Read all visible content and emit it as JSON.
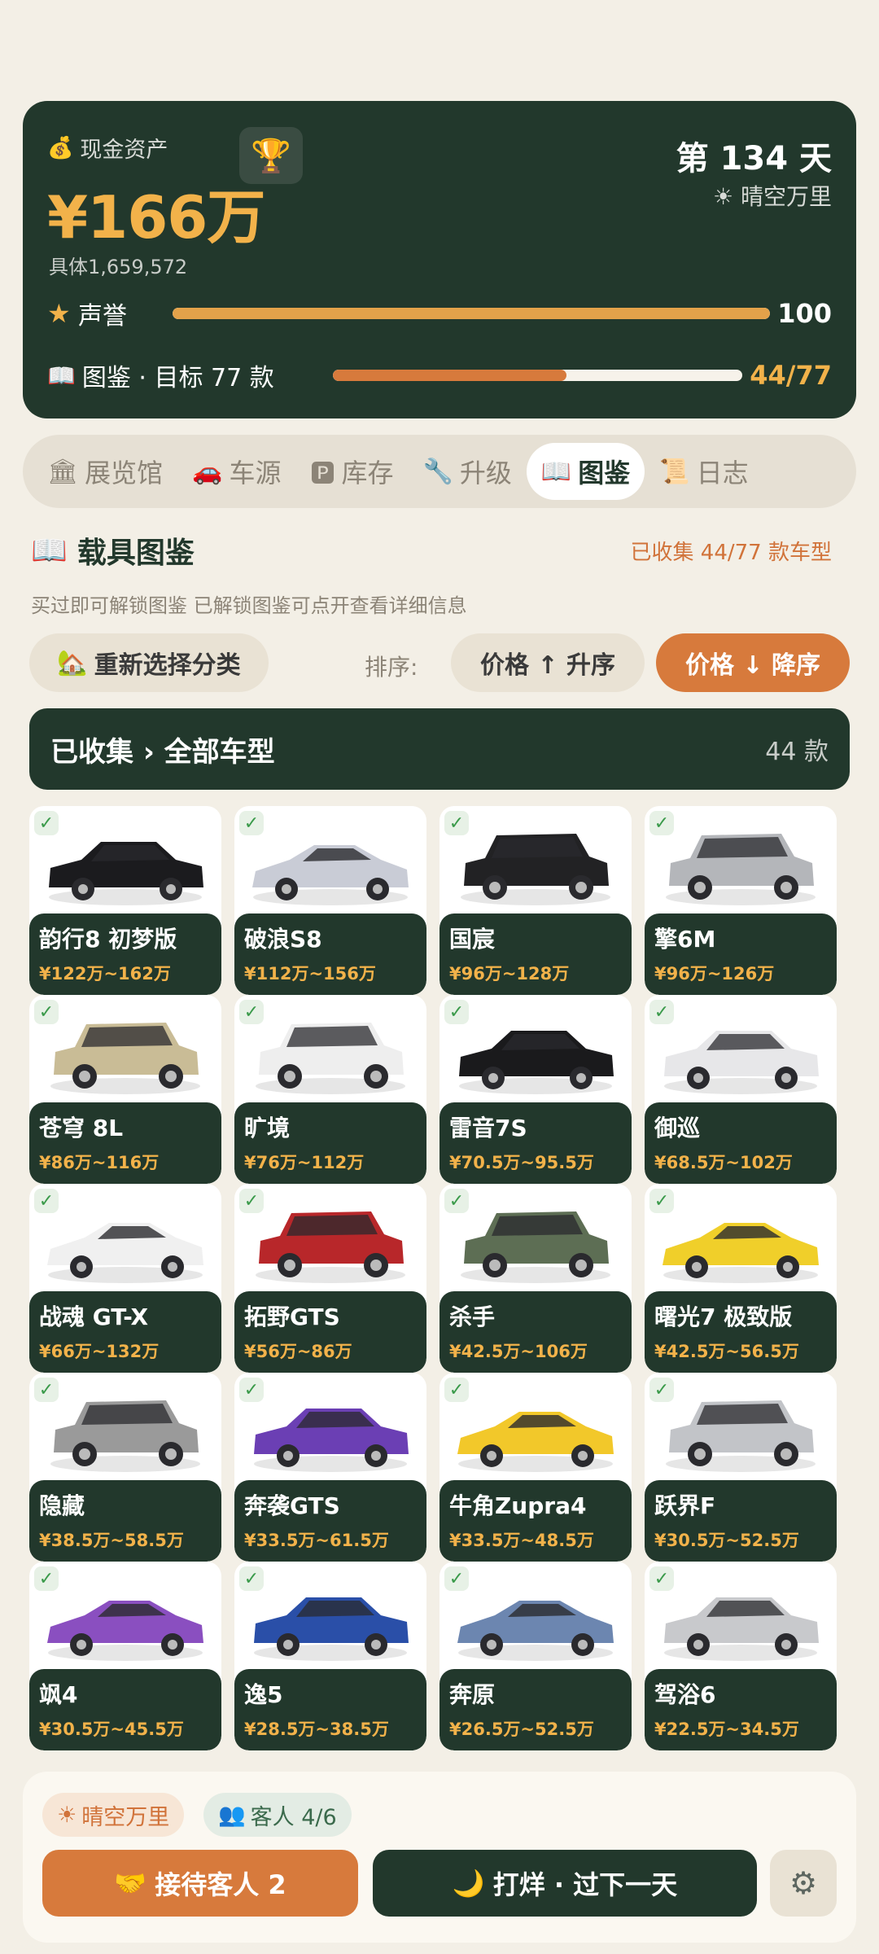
{
  "status": {
    "cash_icon": "money-bag-icon",
    "cash_label": "现金资产",
    "cash_value": "¥166万",
    "cash_detail": "具体1,659,572",
    "trophy_icon": "trophy-icon",
    "day": "第 134 天",
    "weather_icon": "sun-icon",
    "weather": "晴空万里",
    "reputation": {
      "icon": "star-icon",
      "label": "声誉",
      "value": "100",
      "progress": 1.0
    },
    "collection": {
      "icon": "book-icon",
      "label": "图鉴 · 目标 77 款",
      "value": "44/77",
      "progress": 0.5714
    },
    "colors": {
      "card_bg": "#22382c",
      "accent_gold": "#f2b24a",
      "accent_orange": "#d77a3c"
    }
  },
  "tabs": [
    {
      "icon": "museum-icon",
      "glyph": "🏛",
      "label": "展览馆",
      "active": false
    },
    {
      "icon": "car-icon",
      "glyph": "🚗",
      "label": "车源",
      "active": false
    },
    {
      "icon": "parking-icon",
      "glyph": "🅿",
      "label": "库存",
      "active": false
    },
    {
      "icon": "wrench-icon",
      "glyph": "🔧",
      "label": "升级",
      "active": false
    },
    {
      "icon": "book-icon",
      "glyph": "📖",
      "label": "图鉴",
      "active": true
    },
    {
      "icon": "scroll-icon",
      "glyph": "📜",
      "label": "日志",
      "active": false
    }
  ],
  "section": {
    "title_icon": "book-icon",
    "title": "载具图鉴",
    "collected": "已收集 44/77 款车型",
    "hint": "买过即可解锁图鉴 已解锁图鉴可点开查看详细信息",
    "reselect_icon": "house-icon",
    "reselect": "重新选择分类",
    "sort_label": "排序:",
    "sort_asc": "价格 ↑ 升序",
    "sort_desc": "价格 ↓ 降序",
    "filter_title": "已收集 › 全部车型",
    "filter_count": "44 款"
  },
  "cars": [
    {
      "name": "韵行8 初梦版",
      "price": "¥122万~162万",
      "color": "#1b1b1e",
      "shape": "sedan"
    },
    {
      "name": "破浪S8",
      "price": "¥112万~156万",
      "color": "#c9ccd6",
      "shape": "sport"
    },
    {
      "name": "国宸",
      "price": "¥96万~128万",
      "color": "#222224",
      "shape": "suv"
    },
    {
      "name": "擎6M",
      "price": "¥96万~126万",
      "color": "#b4b6ba",
      "shape": "suv"
    },
    {
      "name": "苍穹 8L",
      "price": "¥86万~116万",
      "color": "#c9bc96",
      "shape": "suv"
    },
    {
      "name": "旷境",
      "price": "¥76万~112万",
      "color": "#eeeeee",
      "shape": "suv"
    },
    {
      "name": "雷音7S",
      "price": "¥70.5万~95.5万",
      "color": "#1a1a1c",
      "shape": "sedan"
    },
    {
      "name": "御巡",
      "price": "¥68.5万~102万",
      "color": "#e7e7e9",
      "shape": "sedan"
    },
    {
      "name": "战魂 GT-X",
      "price": "¥66万~132万",
      "color": "#f0f0f0",
      "shape": "sport"
    },
    {
      "name": "拓野GTS",
      "price": "¥56万~86万",
      "color": "#b8272a",
      "shape": "suv"
    },
    {
      "name": "杀手",
      "price": "¥42.5万~106万",
      "color": "#5d6e54",
      "shape": "suv"
    },
    {
      "name": "曙光7 极致版",
      "price": "¥42.5万~56.5万",
      "color": "#f0cf2a",
      "shape": "sport"
    },
    {
      "name": "隐藏",
      "price": "¥38.5万~58.5万",
      "color": "#9a9a9a",
      "shape": "suv"
    },
    {
      "name": "奔袭GTS",
      "price": "¥33.5万~61.5万",
      "color": "#6b3fb4",
      "shape": "sedan"
    },
    {
      "name": "牛角Zupra4",
      "price": "¥33.5万~48.5万",
      "color": "#f2c82a",
      "shape": "sport"
    },
    {
      "name": "跃界F",
      "price": "¥30.5万~52.5万",
      "color": "#c2c4c8",
      "shape": "suv"
    },
    {
      "name": "飒4",
      "price": "¥30.5万~45.5万",
      "color": "#8a4fc0",
      "shape": "sport"
    },
    {
      "name": "逸5",
      "price": "¥28.5万~38.5万",
      "color": "#2a4fa8",
      "shape": "sedan"
    },
    {
      "name": "奔原",
      "price": "¥26.5万~52.5万",
      "color": "#6c86b0",
      "shape": "sport"
    },
    {
      "name": "驾浴6",
      "price": "¥22.5万~34.5万",
      "color": "#c8c9cc",
      "shape": "sedan"
    }
  ],
  "bottom": {
    "weather_chip": "晴空万里",
    "weather_icon": "sun-icon",
    "guests_chip": "客人 4/6",
    "guests_icon": "people-icon",
    "receive_icon": "handshake-icon",
    "receive": "接待客人 2",
    "close_icon": "moon-icon",
    "close": "打烊 · 过下一天",
    "settings_icon": "gear-icon"
  }
}
